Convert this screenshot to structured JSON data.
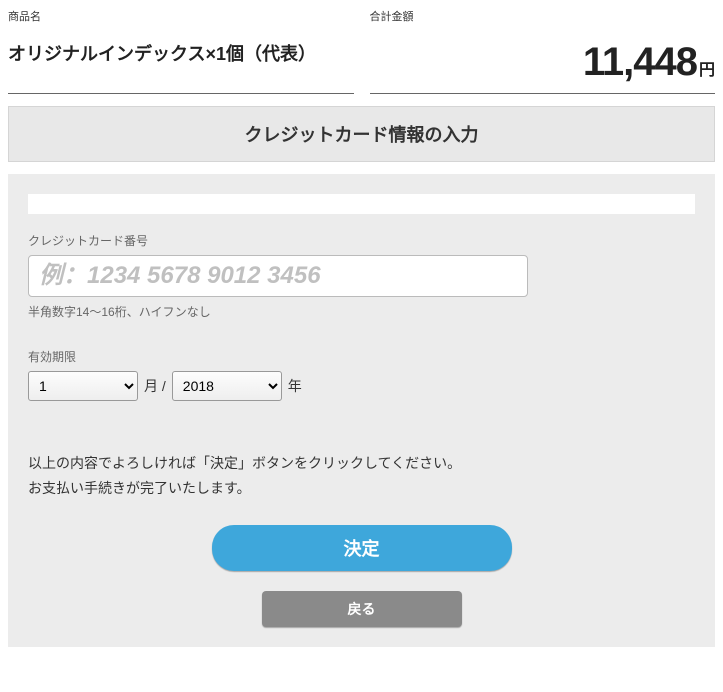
{
  "summary": {
    "product_label": "商品名",
    "product_name": "オリジナルインデックス×1個（代表）",
    "total_label": "合計金額",
    "total_value": "11,448",
    "total_unit": "円"
  },
  "section_title": "クレジットカード情報の入力",
  "cc": {
    "label": "クレジットカード番号",
    "placeholder": "例：1234 5678 9012 3456",
    "hint": "半角数字14〜16桁、ハイフンなし"
  },
  "expiry": {
    "label": "有効期限",
    "month": "1",
    "month_suffix": "月 /",
    "year": "2018",
    "year_suffix": "年"
  },
  "confirm_line1": "以上の内容でよろしければ「決定」ボタンをクリックしてください。",
  "confirm_line2": "お支払い手続きが完了いたします。",
  "buttons": {
    "submit": "決定",
    "back": "戻る"
  }
}
